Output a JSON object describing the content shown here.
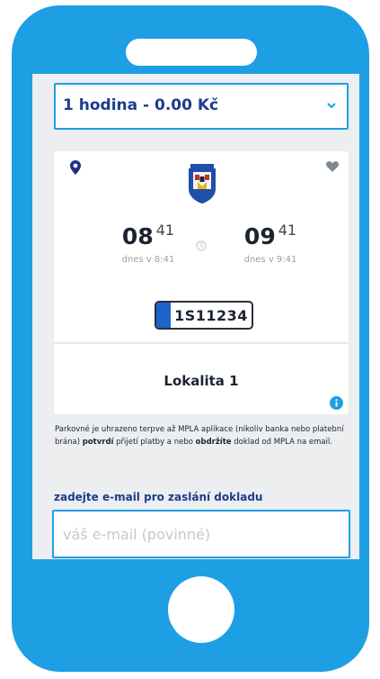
{
  "duration": {
    "selected": "1 hodina - 0.00 Kč",
    "chevron_icon": "chevron-down-icon"
  },
  "card": {
    "pin_icon": "location-pin-icon",
    "favorite_icon": "heart-icon",
    "crest_icon": "city-coat-of-arms-icon",
    "start": {
      "hours": "08",
      "minutes": "41",
      "label": "dnes v 8:41"
    },
    "end": {
      "hours": "09",
      "minutes": "41",
      "label": "dnes v 9:41"
    },
    "clock_icon": "clock-icon",
    "plate": "1S11234",
    "location": "Lokalita 1",
    "info_icon": "info-icon"
  },
  "notice": {
    "part1": "Parkovné je uhrazeno terpve až MPLA aplikace (nikoliv banka nebo platební brána) ",
    "bold1": "potvrdí",
    "part2": " přijetí platby a nebo ",
    "bold2": "obdržíte",
    "part3": " doklad od MPLA na email."
  },
  "email": {
    "label": "zadejte e-mail pro zaslání dokladu",
    "placeholder": "váš e-mail (povinné)",
    "value": ""
  },
  "colors": {
    "phone_body": "#1e9fe4",
    "accent": "#1e9fe4",
    "heading": "#1e3c8c",
    "plate_strip": "#1e63c7"
  }
}
